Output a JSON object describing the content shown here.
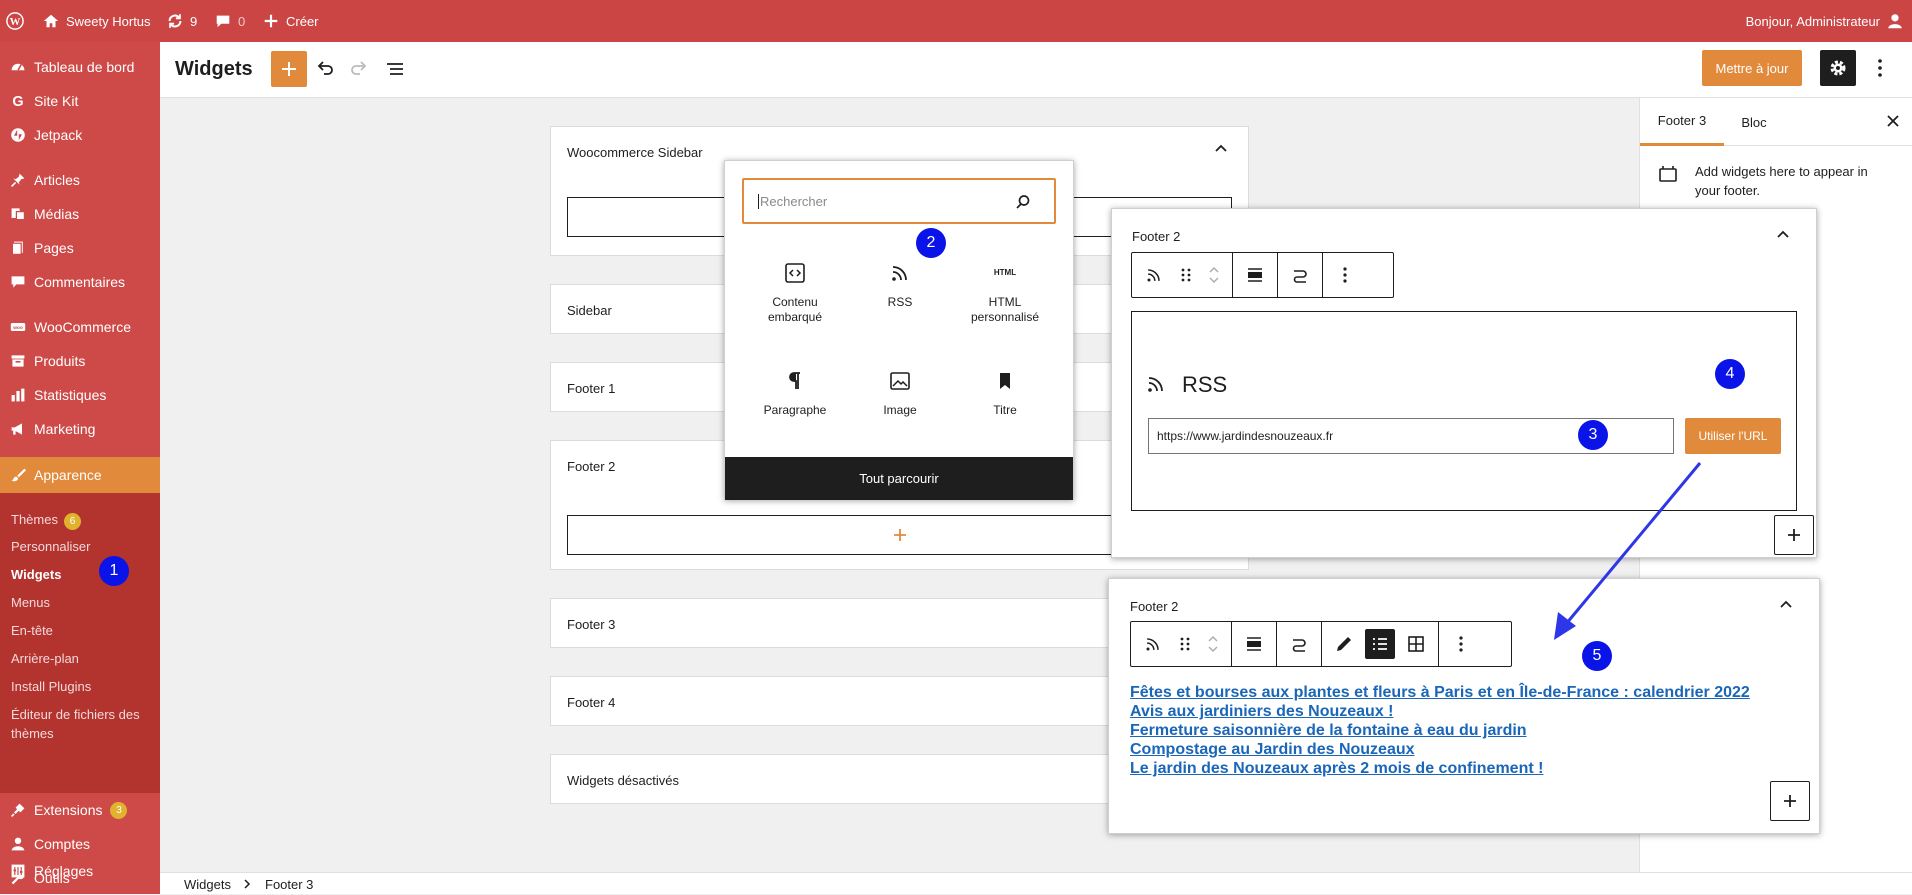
{
  "admin_bar": {
    "site_name": "Sweety Hortus",
    "updates_count": "9",
    "comments_count": "0",
    "create_label": "Créer",
    "greeting": "Bonjour, Administrateur"
  },
  "sidebar": {
    "items": [
      {
        "label": "Tableau de bord",
        "icon": "dashboard-icon"
      },
      {
        "label": "Site Kit",
        "icon": "google-g-icon"
      },
      {
        "label": "Jetpack",
        "icon": "jetpack-icon"
      },
      {
        "label": "Articles",
        "icon": "pin-icon"
      },
      {
        "label": "Médias",
        "icon": "media-icon"
      },
      {
        "label": "Pages",
        "icon": "page-icon"
      },
      {
        "label": "Commentaires",
        "icon": "comment-icon"
      },
      {
        "label": "WooCommerce",
        "icon": "woo-icon"
      },
      {
        "label": "Produits",
        "icon": "archive-icon"
      },
      {
        "label": "Statistiques",
        "icon": "bar-chart-icon"
      },
      {
        "label": "Marketing",
        "icon": "megaphone-icon"
      },
      {
        "label": "Apparence",
        "icon": "paintbrush-icon"
      }
    ],
    "submenu": [
      {
        "label": "Thèmes",
        "badge": "6"
      },
      {
        "label": "Personnaliser"
      },
      {
        "label": "Widgets"
      },
      {
        "label": "Menus"
      },
      {
        "label": "En-tête"
      },
      {
        "label": "Arrière-plan"
      },
      {
        "label": "Install Plugins"
      },
      {
        "label": "Éditeur de fichiers des"
      },
      {
        "label": "thèmes"
      }
    ],
    "bottom_items": [
      {
        "label": "Extensions",
        "badge": "3",
        "icon": "plugin-icon"
      },
      {
        "label": "Comptes",
        "icon": "user-icon"
      },
      {
        "label": "Outils",
        "icon": "wrench-icon"
      },
      {
        "label": "Réglages",
        "icon": "settings-icon"
      }
    ]
  },
  "header": {
    "title": "Widgets",
    "update_button": "Mettre à jour"
  },
  "widget_areas": [
    "Woocommerce Sidebar",
    "Sidebar",
    "Footer 1",
    "Footer 2",
    "Footer 3",
    "Footer 4",
    "Widgets désactivés"
  ],
  "inserter": {
    "placeholder": "Rechercher",
    "blocks": [
      {
        "label1": "Contenu",
        "label2": "embarqué",
        "icon": "embed-icon"
      },
      {
        "label1": "RSS",
        "label2": "",
        "icon": "rss-icon"
      },
      {
        "label1": "HTML",
        "label2": "personnalisé",
        "icon_text": "HTML"
      },
      {
        "label1": "Paragraphe",
        "label2": "",
        "icon": "paragraph-icon"
      },
      {
        "label1": "Image",
        "label2": "",
        "icon": "image-icon"
      },
      {
        "label1": "Titre",
        "label2": "",
        "icon": "bookmark-icon"
      }
    ],
    "browse_all": "Tout parcourir"
  },
  "inspector": {
    "tab_footer": "Footer 3",
    "tab_block": "Bloc",
    "description": "Add widgets here to appear in your footer."
  },
  "rss_panel": {
    "title": "Footer 2",
    "block_title": "RSS",
    "url_value": "https://www.jardindesnouzeaux.fr",
    "use_url_button": "Utiliser l'URL"
  },
  "feed_panel": {
    "title": "Footer 2",
    "links": [
      "Fêtes et bourses aux plantes et fleurs à Paris et en Île-de-France : calendrier 2022",
      "Avis aux jardiniers des Nouzeaux !",
      "Fermeture saisonnière de la fontaine à eau du jardin",
      "Compostage au Jardin des Nouzeaux",
      "Le jardin des Nouzeaux après 2 mois de confinement !"
    ]
  },
  "annotations": [
    "1",
    "2",
    "3",
    "4",
    "5"
  ],
  "breadcrumb": {
    "root": "Widgets",
    "current": "Footer 3"
  },
  "colors": {
    "admin_red": "#cc4545",
    "accent_orange": "#e18a3c",
    "annotation_blue": "#0a14e8"
  }
}
